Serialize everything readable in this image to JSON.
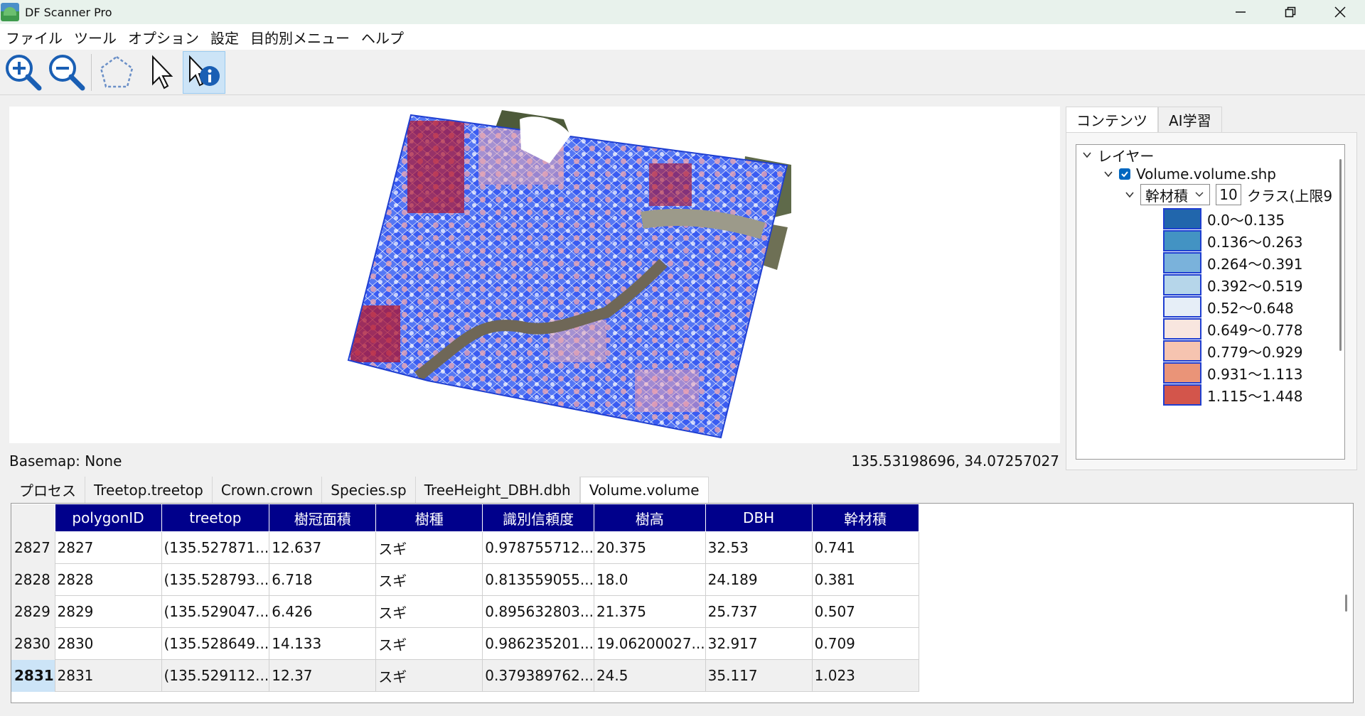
{
  "window": {
    "title": "DF Scanner Pro",
    "icons": {
      "app": "app-landscape-icon",
      "minimize": "minimize-icon",
      "restore": "restore-icon",
      "close": "close-icon"
    }
  },
  "menu": [
    "ファイル",
    "ツール",
    "オプション",
    "設定",
    "目的別メニュー",
    "ヘルプ"
  ],
  "toolbar": [
    {
      "name": "zoom-in-icon",
      "active": false
    },
    {
      "name": "zoom-out-icon",
      "active": false
    },
    {
      "name": "polygon-select-icon",
      "active": false
    },
    {
      "name": "pointer-icon",
      "active": false
    },
    {
      "name": "info-pointer-icon",
      "active": true
    }
  ],
  "map": {
    "basemap_label": "Basemap: None",
    "coordinates": "135.53198696, 34.07257027",
    "colors": {
      "outline": "#1f3fd1",
      "dark_red": "#b4162c",
      "mid_blue": "#3a5cf2",
      "light": "#e6e9f7"
    }
  },
  "right_panel": {
    "tabs": [
      "コンテンツ",
      "AI学習"
    ],
    "active_tab": 0,
    "tree": {
      "root_label": "レイヤー",
      "layer_name": "Volume.volume.shp",
      "layer_checked": true,
      "field_select": "幹材積",
      "class_count": "10",
      "class_suffix": "クラス(上限9",
      "legend": [
        {
          "label": "0.0〜0.135",
          "color": "#2166ac"
        },
        {
          "label": "0.136〜0.263",
          "color": "#4393c3"
        },
        {
          "label": "0.264〜0.391",
          "color": "#7ab2db"
        },
        {
          "label": "0.392〜0.519",
          "color": "#b6d6ea"
        },
        {
          "label": "0.52〜0.648",
          "color": "#e6eef7"
        },
        {
          "label": "0.649〜0.778",
          "color": "#f8e6df"
        },
        {
          "label": "0.779〜0.929",
          "color": "#f6c4b0"
        },
        {
          "label": "0.931〜1.113",
          "color": "#ea9478"
        },
        {
          "label": "1.115〜1.448",
          "color": "#d3554b"
        }
      ]
    }
  },
  "bottom_tabs": [
    "プロセス",
    "Treetop.treetop",
    "Crown.crown",
    "Species.sp",
    "TreeHeight_DBH.dbh",
    "Volume.volume"
  ],
  "bottom_active_tab": 5,
  "table": {
    "columns": [
      "polygonID",
      "treetop",
      "樹冠面積",
      "樹種",
      "識別信頼度",
      "樹高",
      "DBH",
      "幹材積"
    ],
    "rows": [
      {
        "header": "2827",
        "cells": [
          "2827",
          "(135.527871...",
          "12.637",
          "スギ",
          "0.978755712...",
          "20.375",
          "32.53",
          "0.741"
        ]
      },
      {
        "header": "2828",
        "cells": [
          "2828",
          "(135.528793...",
          "6.718",
          "スギ",
          "0.813559055...",
          "18.0",
          "24.189",
          "0.381"
        ]
      },
      {
        "header": "2829",
        "cells": [
          "2829",
          "(135.529047...",
          "6.426",
          "スギ",
          "0.895632803...",
          "21.375",
          "25.737",
          "0.507"
        ]
      },
      {
        "header": "2830",
        "cells": [
          "2830",
          "(135.528649...",
          "14.133",
          "スギ",
          "0.986235201...",
          "19.06200027...",
          "32.917",
          "0.709"
        ]
      },
      {
        "header": "2831",
        "cells": [
          "2831",
          "(135.529112...",
          "12.37",
          "スギ",
          "0.379389762...",
          "24.5",
          "35.117",
          "1.023"
        ]
      }
    ],
    "selected_row": 4
  }
}
